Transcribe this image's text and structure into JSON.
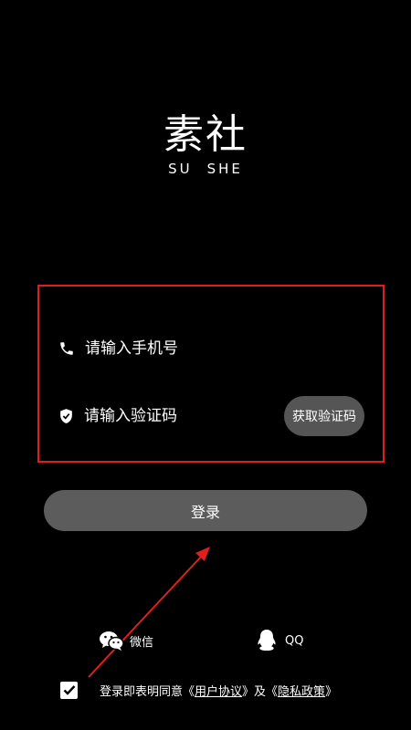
{
  "logo": {
    "cn": "素社",
    "en_left": "SU",
    "en_right": "SHE"
  },
  "form": {
    "phone_placeholder": "请输入手机号",
    "code_placeholder": "请输入验证码",
    "get_code_label": "获取验证码",
    "phone_icon": "phone-icon",
    "code_icon": "shield-check-icon"
  },
  "login": {
    "label": "登录"
  },
  "social": {
    "wechat_label": "微信",
    "qq_label": "QQ"
  },
  "agreement": {
    "checked": true,
    "prefix": "登录即表明同意《",
    "user_agreement": "用户协议",
    "middle": "》及《",
    "privacy_policy": "隐私政策",
    "suffix": "》"
  },
  "colors": {
    "background": "#000000",
    "highlight_border": "#e01e1e",
    "annotation_arrow": "#e01e1e",
    "button_bg": "#5c5c5c",
    "get_code_bg": "#555555"
  }
}
